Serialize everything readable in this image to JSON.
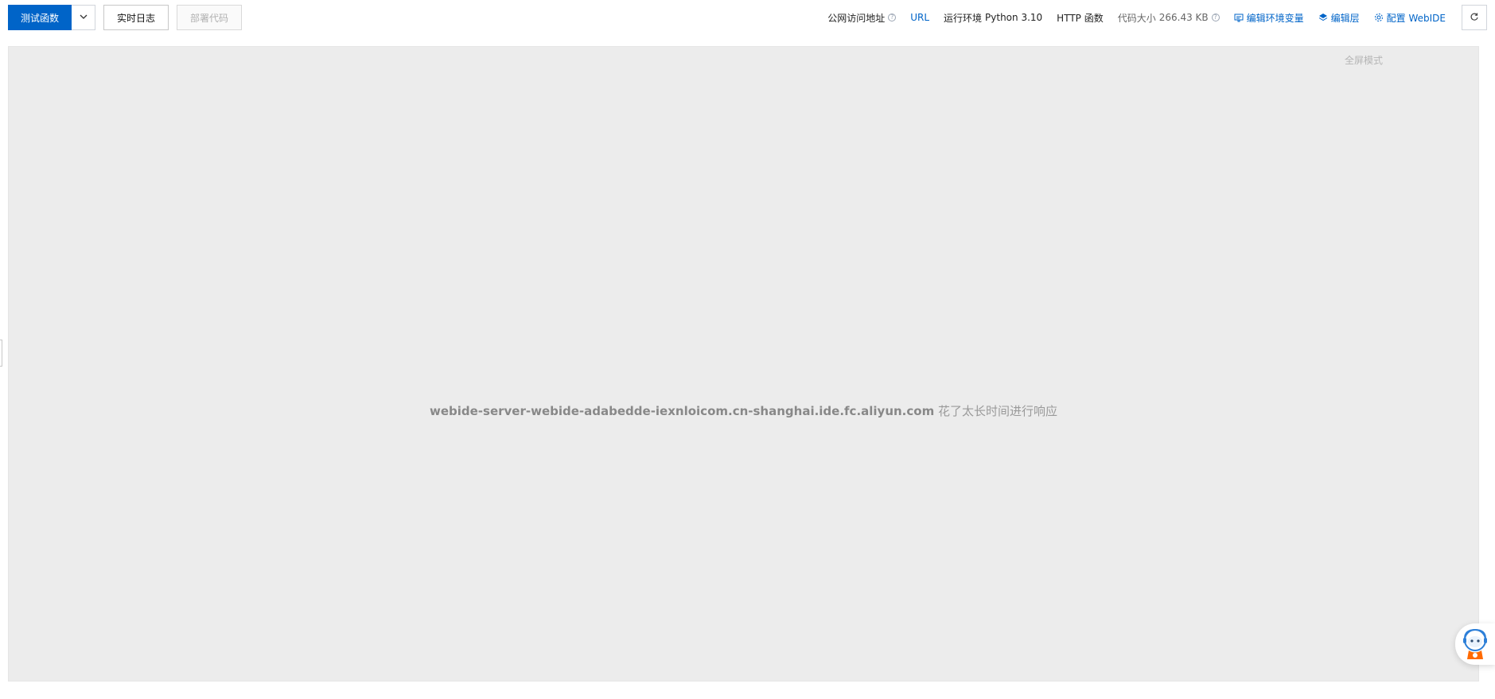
{
  "toolbar": {
    "test_function_label": "测试函数",
    "realtime_log_label": "实时日志",
    "deploy_code_label": "部署代码"
  },
  "info": {
    "public_url_label": "公网访问地址",
    "url_link": "URL",
    "runtime_label": "运行环境",
    "runtime_value": "Python 3.10",
    "trigger_type": "HTTP 函数",
    "code_size_label": "代码大小",
    "code_size_value": "266.43 KB",
    "edit_env_label": "编辑环境变量",
    "edit_layer_label": "编辑层",
    "config_webide_label": "配置 WebIDE"
  },
  "frame": {
    "fullscreen_label": "全屏模式",
    "error_host": "webide-server-webide-adabedde-iexnloicom.cn-shanghai.ide.fc.aliyun.com",
    "error_suffix": "花了太长时间进行响应"
  },
  "colors": {
    "primary": "#0064c8",
    "frame_bg": "#ececec"
  }
}
